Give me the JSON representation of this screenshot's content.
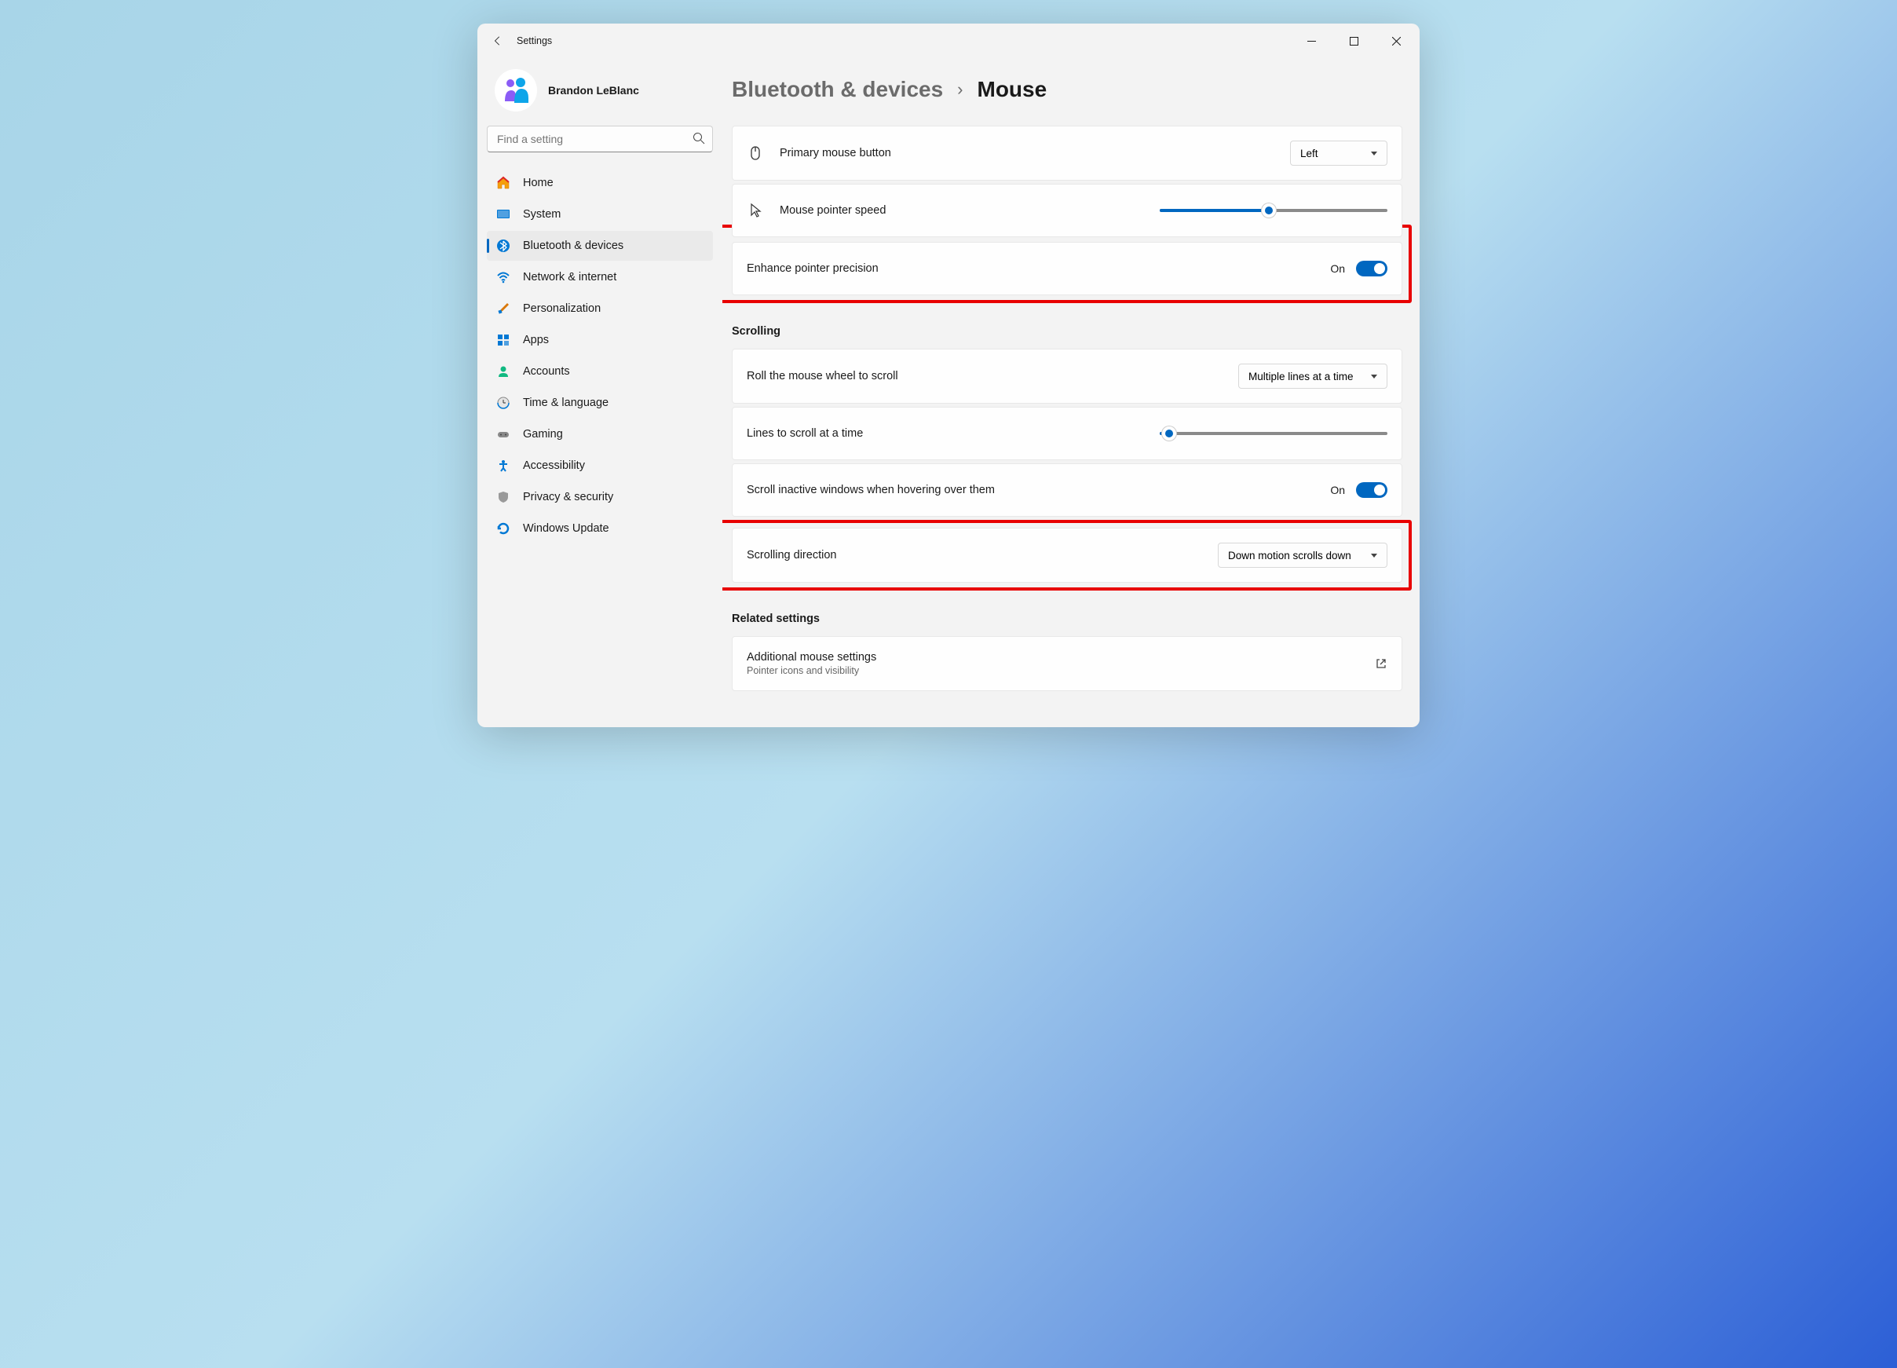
{
  "window": {
    "title": "Settings"
  },
  "user": {
    "name": "Brandon LeBlanc"
  },
  "search": {
    "placeholder": "Find a setting"
  },
  "nav": [
    {
      "id": "home",
      "label": "Home"
    },
    {
      "id": "system",
      "label": "System"
    },
    {
      "id": "bluetooth",
      "label": "Bluetooth & devices",
      "active": true
    },
    {
      "id": "network",
      "label": "Network & internet"
    },
    {
      "id": "personalization",
      "label": "Personalization"
    },
    {
      "id": "apps",
      "label": "Apps"
    },
    {
      "id": "accounts",
      "label": "Accounts"
    },
    {
      "id": "time",
      "label": "Time & language"
    },
    {
      "id": "gaming",
      "label": "Gaming"
    },
    {
      "id": "accessibility",
      "label": "Accessibility"
    },
    {
      "id": "privacy",
      "label": "Privacy & security"
    },
    {
      "id": "update",
      "label": "Windows Update"
    }
  ],
  "breadcrumb": {
    "parent": "Bluetooth & devices",
    "current": "Mouse"
  },
  "settings": {
    "primary_button": {
      "label": "Primary mouse button",
      "value": "Left"
    },
    "pointer_speed": {
      "label": "Mouse pointer speed",
      "value": 48
    },
    "enhance_precision": {
      "label": "Enhance pointer precision",
      "state": "On"
    },
    "scrolling_header": "Scrolling",
    "wheel_scroll": {
      "label": "Roll the mouse wheel to scroll",
      "value": "Multiple lines at a time"
    },
    "lines_scroll": {
      "label": "Lines to scroll at a time",
      "value": 4
    },
    "inactive_scroll": {
      "label": "Scroll inactive windows when hovering over them",
      "state": "On"
    },
    "scroll_direction": {
      "label": "Scrolling direction",
      "value": "Down motion scrolls down"
    },
    "related_header": "Related settings",
    "additional": {
      "label": "Additional mouse settings",
      "sub": "Pointer icons and visibility"
    }
  }
}
